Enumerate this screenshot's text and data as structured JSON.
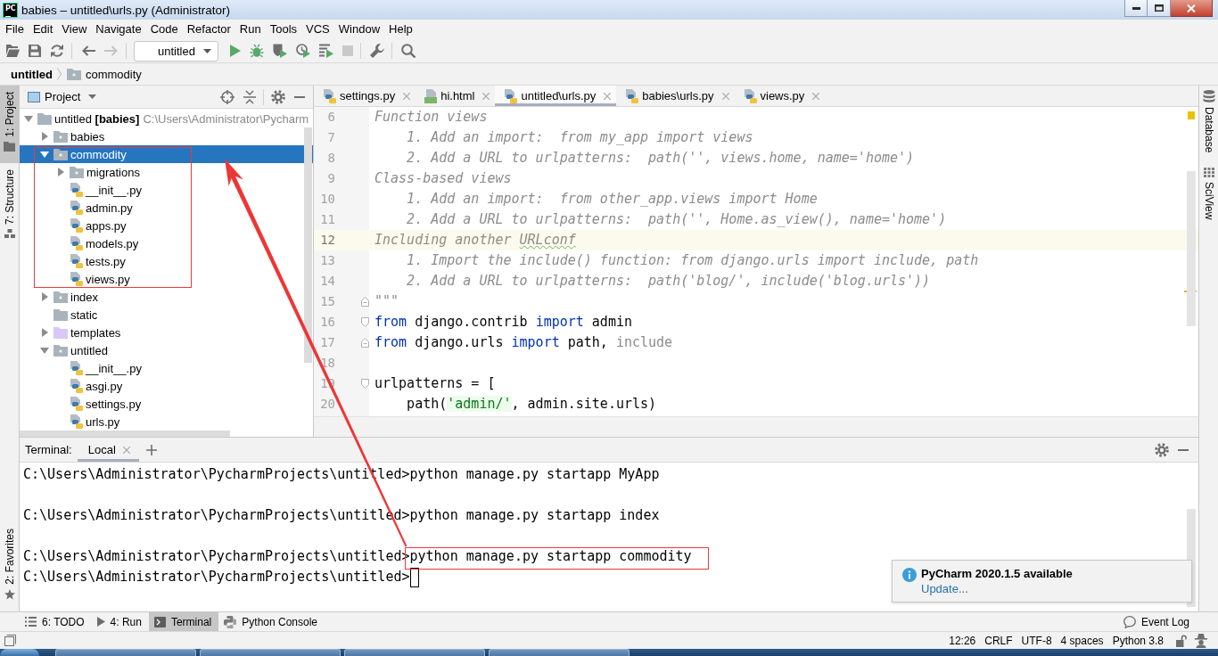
{
  "window": {
    "app_icon": "PC",
    "title": "babies – untitled\\urls.py (Administrator)"
  },
  "menu": [
    "File",
    "Edit",
    "View",
    "Navigate",
    "Code",
    "Refactor",
    "Run",
    "Tools",
    "VCS",
    "Window",
    "Help"
  ],
  "toolbar": {
    "items": [
      {
        "kind": "open",
        "disabled": false
      },
      {
        "kind": "save",
        "disabled": false
      },
      {
        "kind": "sync",
        "disabled": false
      },
      {
        "kind": "separator"
      },
      {
        "kind": "back",
        "disabled": false
      },
      {
        "kind": "forward",
        "disabled": true
      },
      {
        "kind": "separator"
      },
      {
        "kind": "run_config",
        "label": "untitled"
      },
      {
        "kind": "run",
        "disabled": false
      },
      {
        "kind": "debug",
        "disabled": false
      },
      {
        "kind": "coverage",
        "disabled": false
      },
      {
        "kind": "profile",
        "disabled": false
      },
      {
        "kind": "concurrency",
        "disabled": false
      },
      {
        "kind": "stop",
        "disabled": true
      },
      {
        "kind": "separator"
      },
      {
        "kind": "wrench",
        "disabled": false
      },
      {
        "kind": "separator"
      },
      {
        "kind": "search",
        "disabled": false
      }
    ]
  },
  "breadcrumbs": [
    {
      "kind": "project",
      "label": "untitled"
    },
    {
      "kind": "package",
      "label": "commodity"
    }
  ],
  "left_strip": {
    "top": [
      {
        "kind": "project",
        "label": "1: Project",
        "selected": true
      },
      {
        "kind": "structure",
        "label": "7: Structure",
        "selected": false
      }
    ],
    "bottom": [
      {
        "kind": "favorites",
        "label": "2: Favorites",
        "selected": false
      }
    ]
  },
  "project_panel": {
    "title": "Project",
    "tree": [
      {
        "kind": "root",
        "label": "untitled **[babies]**",
        "path": "C:\\Users\\Administrator\\Pycharm",
        "expanded": true,
        "selected": false,
        "children": [
          {
            "kind": "package",
            "label": "babies",
            "expanded": false,
            "selected": false
          },
          {
            "kind": "package",
            "label": "commodity",
            "expanded": true,
            "selected": true,
            "outlined": true,
            "children": [
              {
                "kind": "package",
                "label": "migrations",
                "expanded": false,
                "selected": false
              },
              {
                "kind": "python",
                "label": "__init__.py",
                "selected": false
              },
              {
                "kind": "python",
                "label": "admin.py",
                "selected": false
              },
              {
                "kind": "python",
                "label": "apps.py",
                "selected": false
              },
              {
                "kind": "python",
                "label": "models.py",
                "selected": false
              },
              {
                "kind": "python",
                "label": "tests.py",
                "selected": false
              },
              {
                "kind": "python",
                "label": "views.py",
                "selected": false
              }
            ]
          },
          {
            "kind": "package",
            "label": "index",
            "expanded": false,
            "selected": false
          },
          {
            "kind": "folder",
            "label": "static",
            "selected": false
          },
          {
            "kind": "templates",
            "label": "templates",
            "expanded": false,
            "selected": false
          },
          {
            "kind": "package",
            "label": "untitled",
            "expanded": true,
            "selected": false,
            "children": [
              {
                "kind": "python",
                "label": "__init__.py",
                "selected": false
              },
              {
                "kind": "python",
                "label": "asgi.py",
                "selected": false
              },
              {
                "kind": "python",
                "label": "settings.py",
                "selected": false
              },
              {
                "kind": "python",
                "label": "urls.py",
                "selected": false
              }
            ]
          }
        ]
      }
    ]
  },
  "editor": {
    "tabs": [
      {
        "kind": "python",
        "label": "settings.py",
        "selected": false
      },
      {
        "kind": "html",
        "label": "hi.html",
        "selected": false
      },
      {
        "kind": "python",
        "label": "untitled\\urls.py",
        "selected": true
      },
      {
        "kind": "python",
        "label": "babies\\urls.py",
        "selected": false
      },
      {
        "kind": "python",
        "label": "views.py",
        "selected": false
      }
    ],
    "warnings": true,
    "lines": [
      {
        "number": "6",
        "current": false,
        "segments": [
          {
            "kind": "doc",
            "text": "Function views"
          }
        ]
      },
      {
        "number": "7",
        "current": false,
        "segments": [
          {
            "kind": "doc",
            "text": "    1. Add an import:  from my_app import views"
          }
        ]
      },
      {
        "number": "8",
        "current": false,
        "segments": [
          {
            "kind": "doc",
            "text": "    2. Add a URL to urlpatterns:  path('', views.home, name='home')"
          }
        ]
      },
      {
        "number": "9",
        "current": false,
        "segments": [
          {
            "kind": "doc",
            "text": "Class-based views"
          }
        ]
      },
      {
        "number": "10",
        "current": false,
        "segments": [
          {
            "kind": "doc",
            "text": "    1. Add an import:  from other_app.views import Home"
          }
        ]
      },
      {
        "number": "11",
        "current": false,
        "segments": [
          {
            "kind": "doc",
            "text": "    2. Add a URL to urlpatterns:  path('', Home.as_view(), name='home')"
          }
        ]
      },
      {
        "number": "12",
        "current": true,
        "segments": [
          {
            "kind": "doc",
            "text": "Including another "
          },
          {
            "kind": "typo",
            "text": "URLconf"
          }
        ]
      },
      {
        "number": "13",
        "current": false,
        "segments": [
          {
            "kind": "doc",
            "text": "    1. Import the include() function: from django.urls import include, path"
          }
        ]
      },
      {
        "number": "14",
        "current": false,
        "segments": [
          {
            "kind": "doc",
            "text": "    2. Add a URL to urlpatterns:  path('blog/', include('blog.urls'))"
          }
        ]
      },
      {
        "number": "15",
        "current": false,
        "fold_end": true,
        "segments": [
          {
            "kind": "doc",
            "text": "\"\"\""
          }
        ]
      },
      {
        "number": "16",
        "current": false,
        "fold_start": true,
        "segments": [
          {
            "kind": "keyword",
            "text": "from"
          },
          {
            "kind": "plain",
            "text": " django.contrib "
          },
          {
            "kind": "keyword",
            "text": "import"
          },
          {
            "kind": "plain",
            "text": " admin"
          }
        ]
      },
      {
        "number": "17",
        "current": false,
        "fold_end": true,
        "segments": [
          {
            "kind": "keyword",
            "text": "from"
          },
          {
            "kind": "plain",
            "text": " django.urls "
          },
          {
            "kind": "keyword",
            "text": "import"
          },
          {
            "kind": "plain",
            "text": " path, "
          },
          {
            "kind": "unused",
            "text": "include"
          }
        ]
      },
      {
        "number": "18",
        "current": false
      },
      {
        "number": "19",
        "current": false,
        "fold_start": true,
        "segments": [
          {
            "kind": "plain",
            "text": "urlpatterns = ["
          }
        ]
      },
      {
        "number": "20",
        "current": false,
        "segments": [
          {
            "kind": "plain",
            "text": "    path("
          },
          {
            "kind": "string",
            "text": "'admin/'"
          },
          {
            "kind": "plain",
            "text": ", admin.site.urls)"
          }
        ]
      }
    ]
  },
  "right_strip": [
    {
      "kind": "database",
      "label": "Database",
      "selected": false
    },
    {
      "kind": "sciview",
      "label": "SciView",
      "selected": false
    }
  ],
  "terminal": {
    "title": "Terminal:",
    "tabs": [
      {
        "label": "Local",
        "selected": true
      }
    ],
    "lines": [
      {
        "prompt": "C:\\Users\\Administrator\\PycharmProjects\\untitled>",
        "command": "python manage.py startapp MyApp",
        "outlined": false,
        "cursor": false
      },
      {
        "prompt": "C:\\Users\\Administrator\\PycharmProjects\\untitled>",
        "command": "python manage.py startapp index",
        "outlined": false,
        "cursor": false
      },
      {
        "prompt": "C:\\Users\\Administrator\\PycharmProjects\\untitled>",
        "command": "python manage.py startapp commodity",
        "outlined": true,
        "cursor": false
      },
      {
        "prompt": "C:\\Users\\Administrator\\PycharmProjects\\untitled>",
        "outlined": false,
        "cursor": true
      }
    ]
  },
  "notification": {
    "title": "PyCharm 2020.1.5 available",
    "link": "Update..."
  },
  "bottom_bar": {
    "tabs": [
      {
        "kind": "todo",
        "label": "6: TODO",
        "selected": false
      },
      {
        "kind": "run",
        "label": "4: Run",
        "selected": false
      },
      {
        "kind": "terminal",
        "label": "Terminal",
        "selected": true
      },
      {
        "kind": "console",
        "label": "Python Console",
        "selected": false
      }
    ],
    "event_log": "Event Log"
  },
  "status_bar": {
    "items": [
      "12:26",
      "CRLF",
      "UTF-8",
      "4 spaces",
      "Python 3.8"
    ]
  },
  "annotation_arrow": true
}
